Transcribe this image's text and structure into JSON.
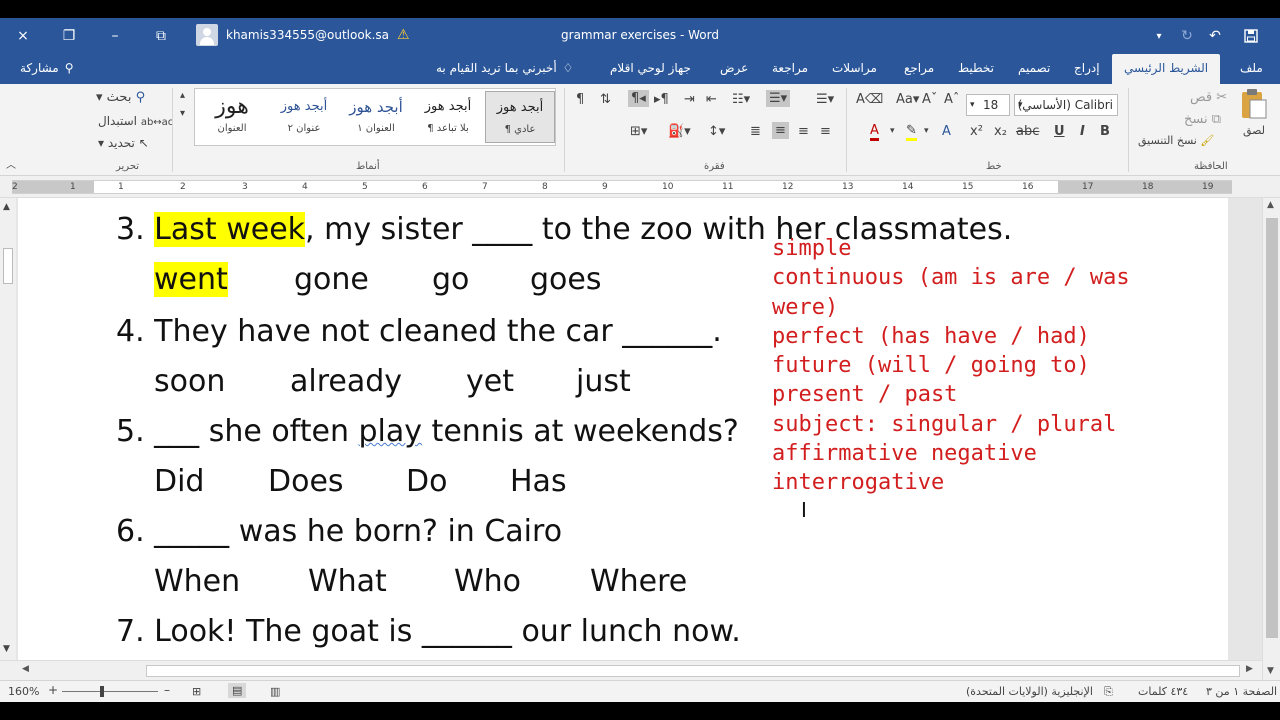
{
  "titlebar": {
    "account_email": "khamis334555@outlook.sa",
    "document_title": "grammar exercises  -  Word",
    "close_icon": "×",
    "restore_icon": "❐",
    "minimize_icon": "–",
    "fullscreen_icon": "⧉"
  },
  "tabs": {
    "file": "ملف",
    "home": "الشريط الرئيسي",
    "insert": "إدراج",
    "design": "تصميم",
    "layout": "تخطيط",
    "references": "مراجع",
    "mailings": "مراسلات",
    "review": "مراجعة",
    "view": "عرض",
    "pens": "جهاز لوحي اقلام",
    "tell_me": "أخبرني بما تريد القيام به",
    "share": "مشاركة"
  },
  "ribbon": {
    "clipboard": {
      "label": "الحافظة",
      "paste": "لصق",
      "cut": "قص",
      "copy": "نسخ",
      "format_painter": "نسخ التنسيق"
    },
    "font": {
      "label": "خط",
      "font_name": "Calibri (الأساسي)",
      "font_size": "18"
    },
    "paragraph": {
      "label": "فقرة"
    },
    "styles": {
      "label": "أنماط",
      "items": [
        {
          "preview": "أبجد هوز",
          "name": "¶ عادي"
        },
        {
          "preview": "أبجد هوز",
          "name": "¶ بلا تباعد"
        },
        {
          "preview": "أبجد هوز",
          "name": "العنوان ١"
        },
        {
          "preview": "أبجد هوز",
          "name": "عنوان ٢"
        },
        {
          "preview": "هوز",
          "name": "العنوان"
        }
      ]
    },
    "editing": {
      "label": "تحرير",
      "find": "بحث",
      "replace": "استبدال",
      "select": "تحديد"
    }
  },
  "ruler": {
    "numbers": [
      "19",
      "18",
      "17",
      "16",
      "15",
      "14",
      "13",
      "12",
      "11",
      "10",
      "9",
      "8",
      "7",
      "6",
      "5",
      "4",
      "3",
      "2",
      "1",
      "1",
      "2"
    ]
  },
  "document": {
    "q3": {
      "num": "3.",
      "hl": "Last week",
      "rest": ", my sister ____ to the zoo with her classmates."
    },
    "q3_options": [
      "went",
      "gone",
      "go",
      "goes"
    ],
    "q4": {
      "text": "4.  They have not cleaned the car ______."
    },
    "q4_options": [
      "soon",
      "already",
      "yet",
      "just"
    ],
    "q5": {
      "pre": "5. ___ she often ",
      "squig": "play",
      "post": " tennis at weekends?"
    },
    "q5_options": [
      "Did",
      "Does",
      "Do",
      "Has"
    ],
    "q6": {
      "text": "6. _____ was he born? in Cairo"
    },
    "q6_options": [
      "When",
      "What",
      "Who",
      "Where"
    ],
    "q7": {
      "text": "7. Look! The goat is ______ our lunch now."
    },
    "notes": [
      "simple",
      "continuous (am is are / was",
      "were)",
      "perfect (has have / had)",
      "future (will / going to)",
      "present / past",
      "subject: singular / plural",
      "affirmative negative",
      "interrogative"
    ]
  },
  "status": {
    "page": "الصفحة ١ من ٣",
    "words": "٤٣٤ كلمات",
    "language": "الإنجليزية (الولايات المتحدة)",
    "zoom": "160%"
  },
  "colors": {
    "word_blue": "#2b579a",
    "note_red": "#d21e1e",
    "highlight": "#ffff00"
  }
}
